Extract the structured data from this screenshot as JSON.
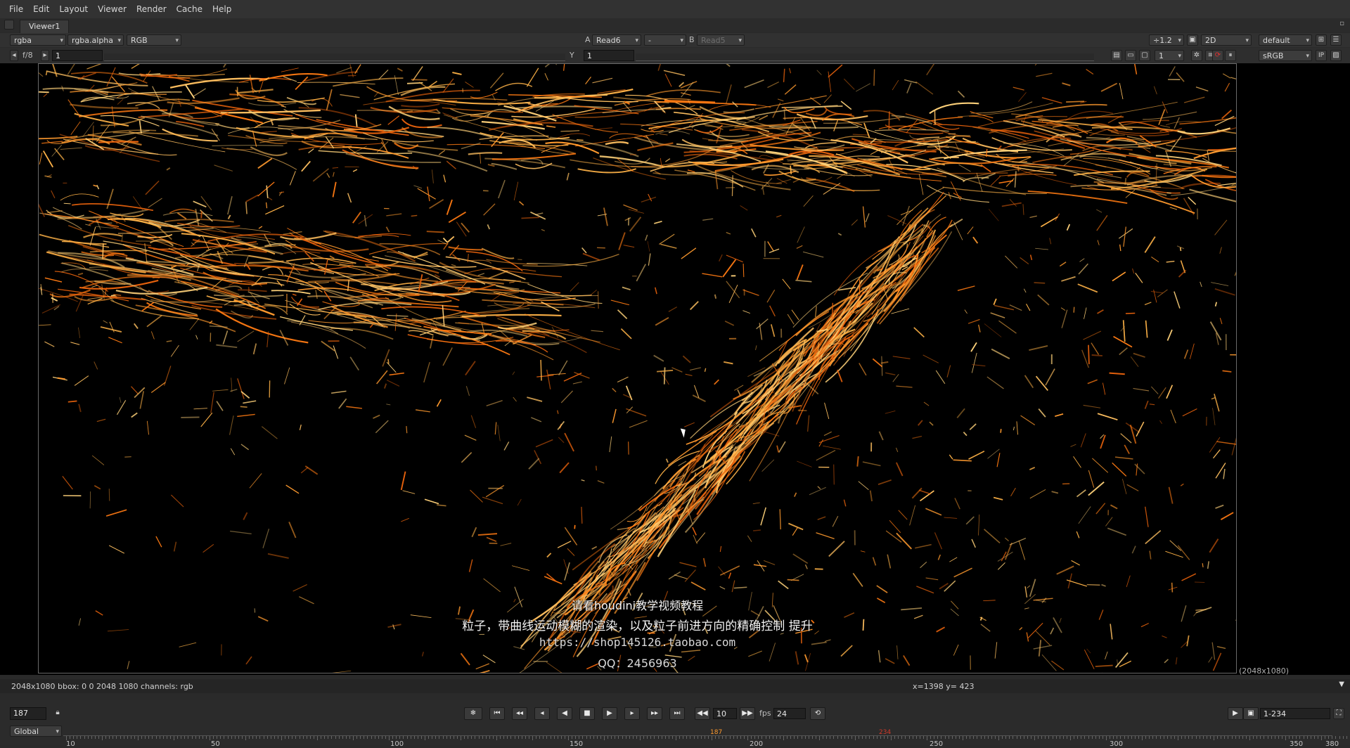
{
  "menubar": {
    "items": [
      "File",
      "Edit",
      "Layout",
      "Viewer",
      "Render",
      "Cache",
      "Help"
    ]
  },
  "tab": {
    "label": "Viewer1"
  },
  "toolbar": {
    "channels": "rgba",
    "alpha_channel": "rgba.alpha",
    "display_channels": "RGB",
    "input_a_label": "A",
    "input_a": "Read6",
    "wipe_mode": "-",
    "input_b_label": "B",
    "input_b": "Read5",
    "downscale": "÷1.2",
    "view_mode": "2D",
    "lut": "default"
  },
  "toolbar2": {
    "fstop": "f/8",
    "gain_value": "1",
    "gamma_label": "Y",
    "gamma_value": "1",
    "proxy_value": "1",
    "colorspace": "sRGB",
    "ip_label": "IP"
  },
  "viewer": {
    "format": "(2048x1080)",
    "subtitle_title": "请看houdini教学视频教程",
    "subtitle_line": "粒子，带曲线运动模糊的渲染，以及粒子前进方向的精确控制 提升",
    "watermark_url": "https://shop145126.taobao.com",
    "watermark_qq": "QQ：2456963"
  },
  "infobar": {
    "left": "2048x1080 bbox: 0 0 2048 1080 channels: rgb",
    "coords": "x=1398 y= 423"
  },
  "timeline": {
    "current_frame": "187",
    "scope": "Global",
    "increment": "10",
    "fps_label": "fps",
    "fps": "24",
    "range": "1-234",
    "marker_current": "187",
    "marker_end": "234",
    "ticks": [
      "10",
      "50",
      "100",
      "150",
      "200",
      "250",
      "300",
      "350",
      "380"
    ]
  },
  "colors": {
    "accent_orange": "#ff8a1c",
    "marker_red": "#d23a2a",
    "viewer_bg": "#000000"
  }
}
